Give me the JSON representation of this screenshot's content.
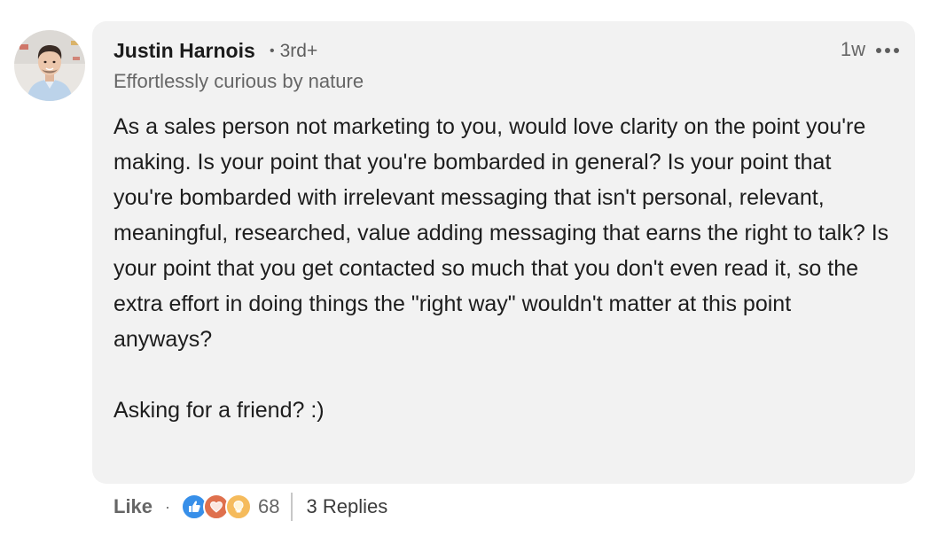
{
  "comment": {
    "author": {
      "name": "Justin Harnois",
      "degree": "3rd+",
      "headline": "Effortlessly curious by nature"
    },
    "timestamp": "1w",
    "text": "As a sales person not marketing to you, would love clarity on the point you're making. Is your point that you're bombarded in general? Is your point that you're bombarded with irrelevant messaging that isn't personal, relevant, meaningful, researched, value adding messaging that earns the right to talk? Is your point that you get contacted so much that you don't even read it, so the extra effort in doing things the \"right way\" wouldn't matter at this point anyways?\n\nAsking for a friend? :)"
  },
  "actions": {
    "like_label": "Like",
    "separator": "·",
    "reaction_count": "68",
    "replies_label": "3 Replies",
    "reactions": [
      {
        "icon": "thumbs-up-icon",
        "color": "#378fe9"
      },
      {
        "icon": "heart-icon",
        "color": "#df704d"
      },
      {
        "icon": "lightbulb-icon",
        "color": "#f5bb5c"
      }
    ]
  },
  "colors": {
    "bubble_background": "#f2f2f2",
    "primary_text": "#1d1d1d",
    "secondary_text": "#666666"
  }
}
